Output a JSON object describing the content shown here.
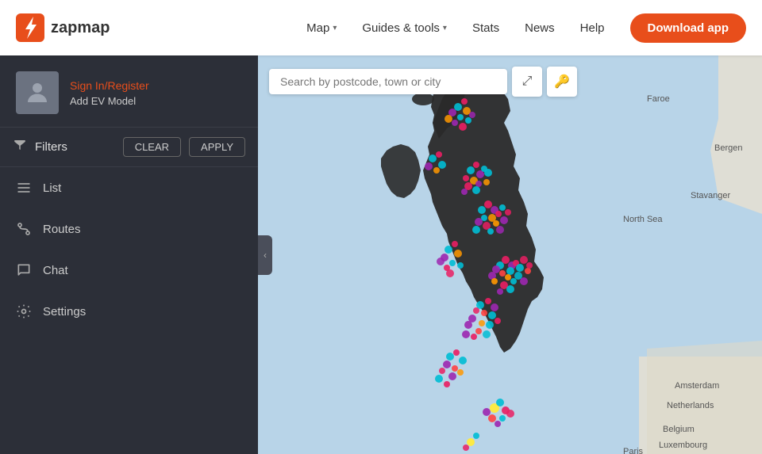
{
  "header": {
    "logo_text": "zapmap",
    "nav_items": [
      {
        "label": "Map",
        "has_dropdown": true
      },
      {
        "label": "Guides & tools",
        "has_dropdown": true
      },
      {
        "label": "Stats",
        "has_dropdown": false
      },
      {
        "label": "News",
        "has_dropdown": false
      },
      {
        "label": "Help",
        "has_dropdown": false
      }
    ],
    "download_btn": "Download app"
  },
  "sidebar": {
    "sign_in": "Sign In/Register",
    "add_ev": "Add EV Model",
    "filters_label": "Filters",
    "clear_label": "CLEAR",
    "apply_label": "APPLY",
    "nav_items": [
      {
        "label": "List",
        "icon": "list"
      },
      {
        "label": "Routes",
        "icon": "routes"
      },
      {
        "label": "Chat",
        "icon": "chat"
      },
      {
        "label": "Settings",
        "icon": "settings"
      }
    ]
  },
  "map": {
    "search_placeholder": "Search by postcode, town or city",
    "labels": [
      "Faroe",
      "Bergen",
      "Stavanger",
      "North Sea",
      "Amsterdam",
      "Netherlands",
      "Belgium",
      "Luxembourg",
      "Paris"
    ]
  }
}
